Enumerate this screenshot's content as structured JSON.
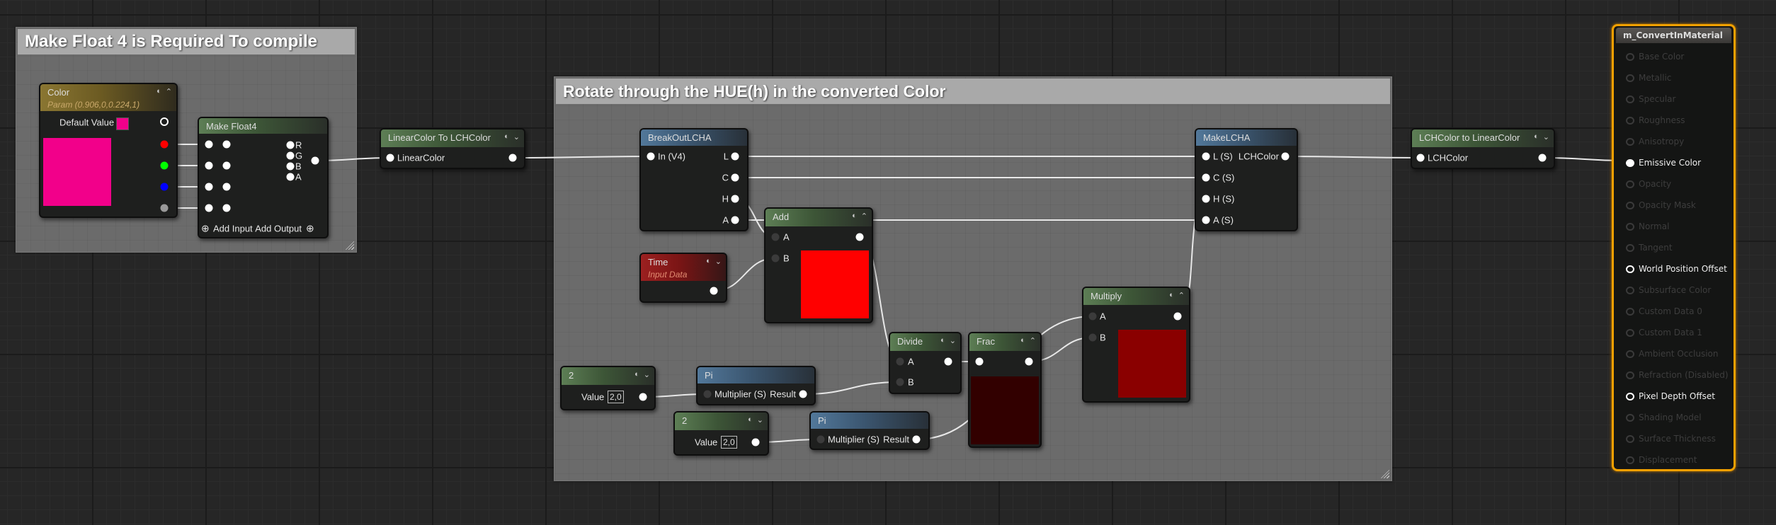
{
  "comments": [
    {
      "title": "Make Float 4 is Required To compile"
    },
    {
      "title": "Rotate through the HUE(h) in the converted Color"
    }
  ],
  "nodes": {
    "color": {
      "title": "Color",
      "subtitle": "Param (0.906,0,0.224,1)",
      "default_value_label": "Default Value",
      "swatch_color": "#f2008a"
    },
    "makefloat4": {
      "title": "Make Float4",
      "outputs": [
        "R",
        "G",
        "B",
        "A"
      ],
      "add_input": "Add Input",
      "add_output": "Add Output"
    },
    "lin2lch": {
      "title": "LinearColor To LCHColor",
      "input": "LinearColor"
    },
    "breakout": {
      "title": "BreakOutLCHA",
      "input": "In (V4)",
      "outputs": [
        "L",
        "C",
        "H",
        "A"
      ]
    },
    "add": {
      "title": "Add",
      "inputs": [
        "A",
        "B"
      ],
      "swatch_color": "#ff0000"
    },
    "time": {
      "title": "Time",
      "subtitle": "Input Data"
    },
    "divide": {
      "title": "Divide",
      "inputs": [
        "A",
        "B"
      ]
    },
    "frac": {
      "title": "Frac",
      "swatch_color": "#320000"
    },
    "const1": {
      "title": "2",
      "value_label": "Value",
      "value": "2,0"
    },
    "pi1": {
      "title": "Pi",
      "input": "Multiplier (S)",
      "output": "Result"
    },
    "const2": {
      "title": "2",
      "value_label": "Value",
      "value": "2,0"
    },
    "pi2": {
      "title": "Pi",
      "input": "Multiplier (S)",
      "output": "Result"
    },
    "multiply": {
      "title": "Multiply",
      "inputs": [
        "A",
        "B"
      ],
      "swatch_color": "#8a0000"
    },
    "makelcha": {
      "title": "MakeLCHA",
      "inputs": [
        "L (S)",
        "C (S)",
        "H (S)",
        "A (S)"
      ],
      "output": "LCHColor"
    },
    "lch2lin": {
      "title": "LCHColor to LinearColor",
      "input": "LCHColor"
    }
  },
  "material": {
    "title": "m_ConvertInMaterial",
    "accent_color": "#f0a000",
    "pins": [
      {
        "label": "Base Color",
        "active": false
      },
      {
        "label": "Metallic",
        "active": false
      },
      {
        "label": "Specular",
        "active": false
      },
      {
        "label": "Roughness",
        "active": false
      },
      {
        "label": "Anisotropy",
        "active": false
      },
      {
        "label": "Emissive Color",
        "active": true,
        "connected": true
      },
      {
        "label": "Opacity",
        "active": false
      },
      {
        "label": "Opacity Mask",
        "active": false
      },
      {
        "label": "Normal",
        "active": false
      },
      {
        "label": "Tangent",
        "active": false
      },
      {
        "label": "World Position Offset",
        "active": true
      },
      {
        "label": "Subsurface Color",
        "active": false
      },
      {
        "label": "Custom Data 0",
        "active": false
      },
      {
        "label": "Custom Data 1",
        "active": false
      },
      {
        "label": "Ambient Occlusion",
        "active": false
      },
      {
        "label": "Refraction (Disabled)",
        "active": false
      },
      {
        "label": "Pixel Depth Offset",
        "active": true
      },
      {
        "label": "Shading Model",
        "active": false
      },
      {
        "label": "Surface Thickness",
        "active": false
      },
      {
        "label": "Displacement",
        "active": false
      }
    ]
  }
}
